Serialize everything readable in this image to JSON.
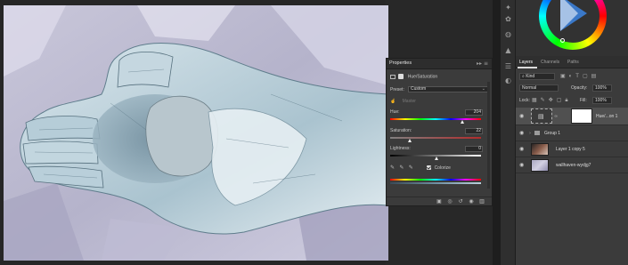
{
  "properties": {
    "tab_label": "Properties",
    "tab_controls": "▸▸ ≡",
    "adjustment_label": "Hue/Saturation",
    "preset_label": "Preset:",
    "preset_value": "Custom",
    "channel_label": "Master",
    "hue_label": "Hue:",
    "hue_value": "204",
    "hue_level": 0.78,
    "saturation_label": "Saturation:",
    "saturation_value": "22",
    "saturation_level": 0.22,
    "lightness_label": "Lightness:",
    "lightness_value": "0",
    "lightness_level": 0.5,
    "colorize_label": "Colorize"
  },
  "layers_panel": {
    "tabs": [
      "Layers",
      "Channels",
      "Paths"
    ],
    "active_tab": "Layers",
    "filter_value": "Kind",
    "blend_mode": "Normal",
    "opacity_label": "Opacity:",
    "opacity_value": "100%",
    "lock_label": "Lock:",
    "fill_label": "Fill:",
    "fill_value": "100%",
    "layers": [
      {
        "name": "Hue/...on 1",
        "type": "adjustment",
        "selected": true
      },
      {
        "name": "Group 1",
        "type": "group",
        "selected": false
      },
      {
        "name": "Layer 1 copy 5",
        "type": "image",
        "selected": false
      },
      {
        "name": "wallhaven-wydjg7",
        "type": "image",
        "selected": false
      }
    ]
  },
  "colors": {
    "accent": "#3a78c8",
    "panel_bg": "#3b3b3b",
    "canvas_bg": "#262626"
  }
}
